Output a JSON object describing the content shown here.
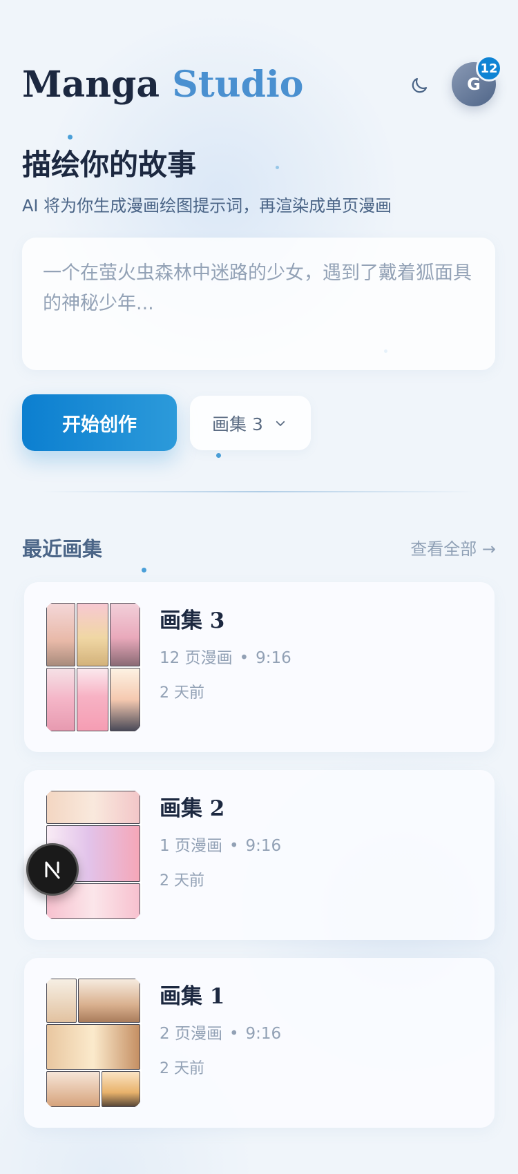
{
  "app": {
    "brand_part1": "Manga",
    "brand_part2": "Studio",
    "avatar_initial": "G",
    "notification_count": "12"
  },
  "hero": {
    "title": "描绘你的故事",
    "subtitle": "AI 将为你生成漫画绘图提示词，再渲染成单页漫画",
    "prompt_placeholder": "一个在萤火虫森林中迷路的少女，遇到了戴着狐面具的神秘少年...",
    "prompt_value": ""
  },
  "actions": {
    "start_label": "开始创作",
    "album_select_value": "画集 3"
  },
  "recent": {
    "title": "最近画集",
    "view_all": "查看全部 →",
    "albums": [
      {
        "title": "画集 3",
        "pages": "12 页漫画",
        "separator": "•",
        "ratio": "9:16",
        "time": "2 天前"
      },
      {
        "title": "画集 2",
        "pages": "1 页漫画",
        "separator": "•",
        "ratio": "9:16",
        "time": "2 天前"
      },
      {
        "title": "画集 1",
        "pages": "2 页漫画",
        "separator": "•",
        "ratio": "9:16",
        "time": "2 天前"
      }
    ]
  },
  "dev_badge": {
    "letter": "N"
  },
  "colors": {
    "accent": "#0e83d4",
    "brand_dark": "#1c2840",
    "brand_blue": "#4a90d0",
    "muted": "#92a1b5",
    "background": "#f0f5fa"
  },
  "icons": {
    "theme_toggle": "moon-icon",
    "select_chevron": "chevron-down-icon",
    "dev_indicator": "nextjs-icon"
  }
}
